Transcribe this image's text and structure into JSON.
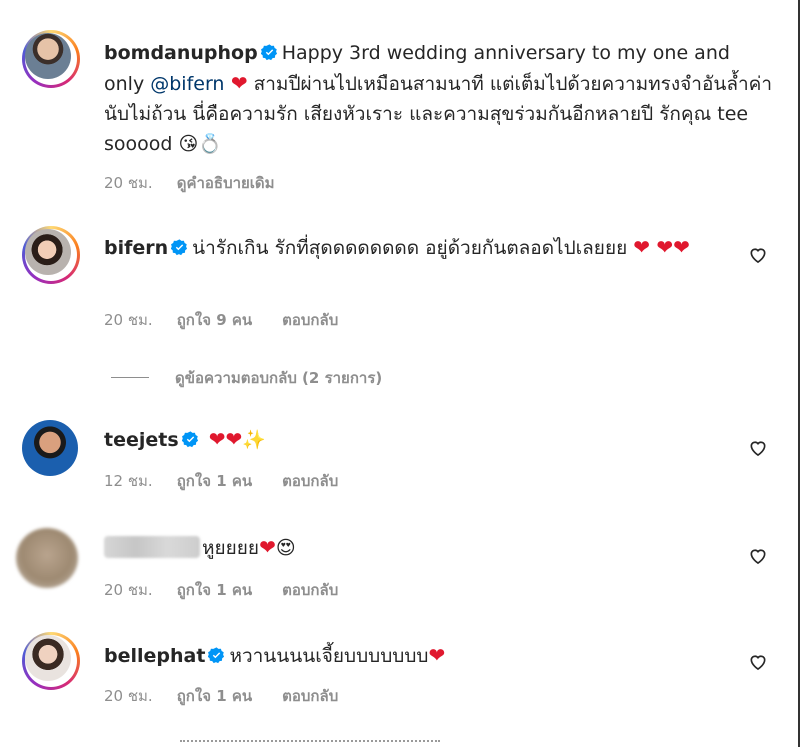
{
  "comments": [
    {
      "username": "bomdanuphop",
      "text_before": "Happy 3rd wedding anniversary to my one and only ",
      "mention": "@bifern",
      "text_after": " สามปีผ่านไปเหมือนสามนาที แต่เต็มไปด้วยความทรงจำอันล้ำค่านับไม่ถ้วน นี่คือความรัก เสียงหัวเราะ และความสุขร่วมกันอีกหลายปี รักคุณ tee sooood",
      "emojis": "😘💍",
      "time": "20 ชม.",
      "see_original": "ดูคำอธิบายเดิม"
    },
    {
      "username": "bifern",
      "text": "น่ารักเกิน รักที่สุดดดดดดดด อยู่ด้วยกันตลอดไปเลยยย",
      "hearts": "❤ ❤❤",
      "time": "20 ชม.",
      "likes": "ถูกใจ 9 คน",
      "reply": "ตอบกลับ",
      "view_replies": "ดูข้อความตอบกลับ (2 รายการ)"
    },
    {
      "username": "teejets",
      "hearts": "❤❤",
      "sparkle": "✨",
      "time": "12 ชม.",
      "likes": "ถูกใจ 1 คน",
      "reply": "ตอบกลับ"
    },
    {
      "text": "หูยยยย",
      "hearts": "❤",
      "emoji": "😍",
      "time": "20 ชม.",
      "likes": "ถูกใจ 1 คน",
      "reply": "ตอบกลับ"
    },
    {
      "username": "bellephat",
      "text": "หวานนนนเจี้ยบบบบบบบ",
      "hearts": "❤",
      "time": "20 ชม.",
      "likes": "ถูกใจ 1 คน",
      "reply": "ตอบกลับ"
    }
  ],
  "colors": {
    "verified": "#0095f6",
    "mention": "#00376b",
    "heart": "#e0182e",
    "meta": "#8e8e8e"
  },
  "icons": [
    "verified-badge-icon",
    "heart-outline-icon"
  ]
}
